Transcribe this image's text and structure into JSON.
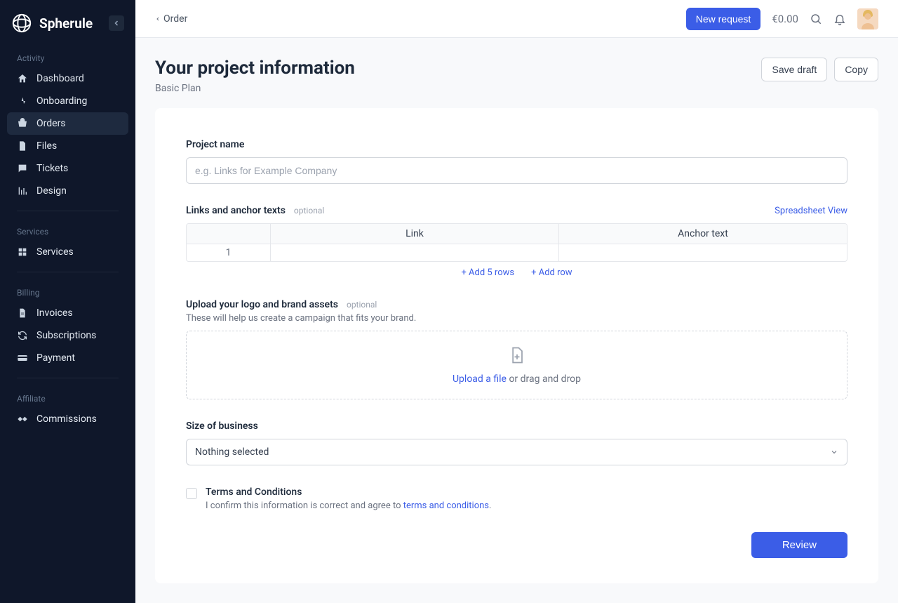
{
  "brand": "Spherule",
  "sidebar": {
    "sections": [
      {
        "label": "Activity",
        "items": [
          {
            "label": "Dashboard",
            "name": "sidebar-item-dashboard",
            "icon": "home-icon"
          },
          {
            "label": "Onboarding",
            "name": "sidebar-item-onboarding",
            "icon": "onboarding-icon"
          },
          {
            "label": "Orders",
            "name": "sidebar-item-orders",
            "icon": "orders-icon",
            "active": true
          },
          {
            "label": "Files",
            "name": "sidebar-item-files",
            "icon": "file-icon"
          },
          {
            "label": "Tickets",
            "name": "sidebar-item-tickets",
            "icon": "chat-icon"
          },
          {
            "label": "Design",
            "name": "sidebar-item-design",
            "icon": "chart-icon"
          }
        ]
      },
      {
        "label": "Services",
        "items": [
          {
            "label": "Services",
            "name": "sidebar-item-services",
            "icon": "services-icon"
          }
        ]
      },
      {
        "label": "Billing",
        "items": [
          {
            "label": "Invoices",
            "name": "sidebar-item-invoices",
            "icon": "invoice-icon"
          },
          {
            "label": "Subscriptions",
            "name": "sidebar-item-subscriptions",
            "icon": "refresh-icon"
          },
          {
            "label": "Payment",
            "name": "sidebar-item-payment",
            "icon": "card-icon"
          }
        ]
      },
      {
        "label": "Affiliate",
        "items": [
          {
            "label": "Commissions",
            "name": "sidebar-item-commissions",
            "icon": "handshake-icon"
          }
        ]
      }
    ]
  },
  "topbar": {
    "breadcrumb": "Order",
    "new_request": "New request",
    "balance": "€0.00"
  },
  "page": {
    "title": "Your project information",
    "subtitle": "Basic Plan",
    "save_draft": "Save draft",
    "copy": "Copy"
  },
  "form": {
    "project_name": {
      "label": "Project name",
      "placeholder": "e.g. Links for Example Company"
    },
    "links": {
      "label": "Links and anchor texts",
      "optional": "optional",
      "spreadsheet_view": "Spreadsheet View",
      "col_link": "Link",
      "col_anchor": "Anchor text",
      "row1_num": "1",
      "add5": "+ Add 5 rows",
      "add1": "+ Add row"
    },
    "upload": {
      "label": "Upload your logo and brand assets",
      "optional": "optional",
      "help": "These will help us create a campaign that fits your brand.",
      "link": "Upload a file",
      "suffix": " or drag and drop"
    },
    "size": {
      "label": "Size of business",
      "value": "Nothing selected"
    },
    "terms": {
      "label": "Terms and Conditions",
      "prefix": "I confirm this information is correct and agree to ",
      "link": "terms and conditions",
      "suffix": "."
    },
    "review": "Review"
  }
}
